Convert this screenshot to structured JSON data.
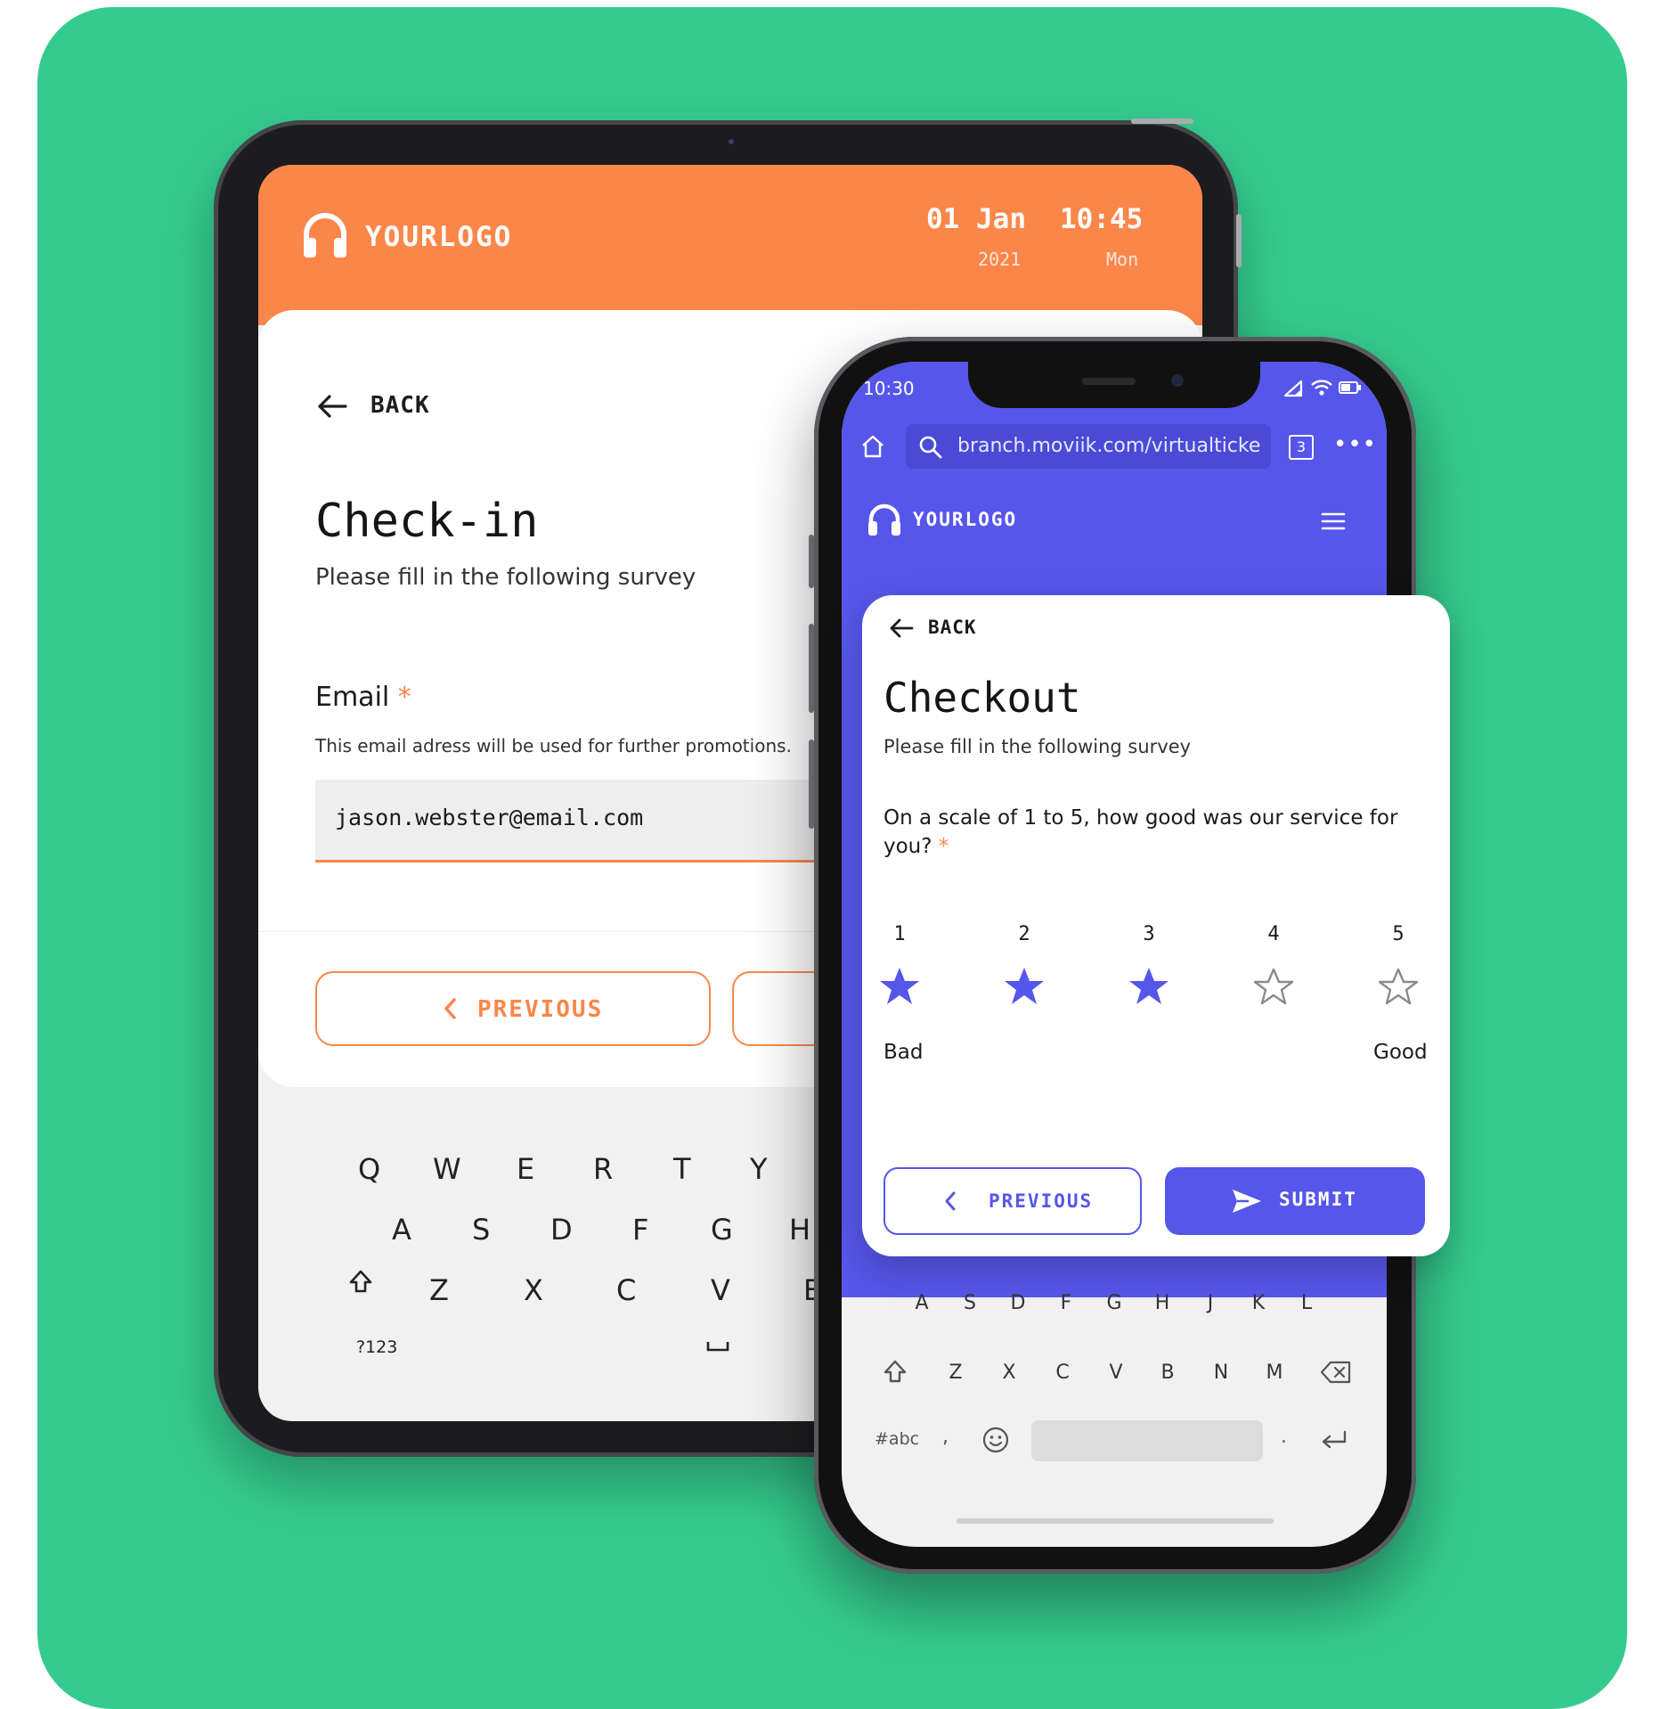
{
  "colors": {
    "background": "#35cb8e",
    "tablet_accent": "#fb864a",
    "phone_accent": "#5656ea",
    "required_star": "#fb864a"
  },
  "tablet": {
    "header": {
      "logo_icon": "headphones-icon",
      "logo_text": "YOURLOGO",
      "date_main": "01 Jan",
      "date_year": "2021",
      "time_main": "10:45",
      "time_day": "Mon"
    },
    "back_label": "BACK",
    "title": "Check-in",
    "subtitle": "Please fill in the following survey",
    "email_label": "Email",
    "required_mark": "*",
    "email_hint": "This email adress will be used for further promotions.",
    "email_value": "jason.webster@email.com",
    "previous_label": "PREVIOUS",
    "keyboard": {
      "row1": [
        "Q",
        "W",
        "E",
        "R",
        "T",
        "Y"
      ],
      "row2": [
        "A",
        "S",
        "D",
        "F",
        "G",
        "H"
      ],
      "row3": [
        "Z",
        "X",
        "C",
        "V",
        "B"
      ],
      "symbols_key": "?123"
    }
  },
  "phone": {
    "status_time": "10:30",
    "browser": {
      "url": "branch.moviik.com/virtualticke",
      "tab_count": "3"
    },
    "logo_text": "YOURLOGO",
    "back_label": "BACK",
    "title": "Checkout",
    "subtitle": "Please fill in the following survey",
    "question": "On a scale of 1 to 5, how good was our service for you?",
    "required_mark": "*",
    "rating": {
      "options": [
        "1",
        "2",
        "3",
        "4",
        "5"
      ],
      "selected": 3,
      "low_label": "Bad",
      "high_label": "Good"
    },
    "previous_label": "PREVIOUS",
    "submit_label": "SUBMIT",
    "keyboard": {
      "row2": [
        "A",
        "S",
        "D",
        "F",
        "G",
        "H",
        "J",
        "K",
        "L"
      ],
      "row3": [
        "Z",
        "X",
        "C",
        "V",
        "B",
        "N",
        "M"
      ],
      "symbols_key": "#abc",
      "comma": ",",
      "period": "."
    }
  }
}
